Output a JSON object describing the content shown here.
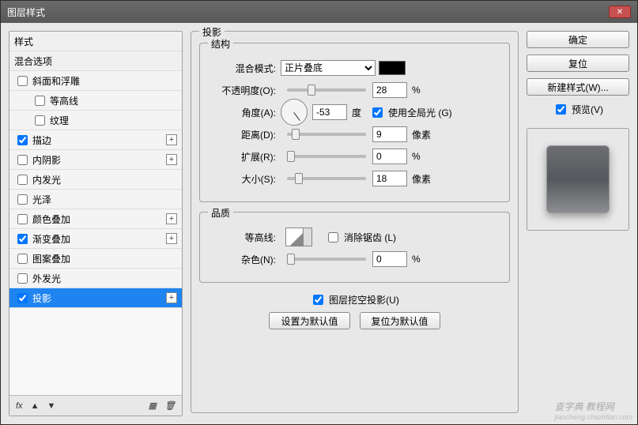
{
  "window": {
    "title": "图层样式"
  },
  "sidebar": {
    "header_styles": "样式",
    "header_blend": "混合选项",
    "items": [
      {
        "label": "斜面和浮雕",
        "checked": false,
        "expandable": false,
        "child": false
      },
      {
        "label": "等高线",
        "checked": false,
        "expandable": false,
        "child": true
      },
      {
        "label": "纹理",
        "checked": false,
        "expandable": false,
        "child": true
      },
      {
        "label": "描边",
        "checked": true,
        "expandable": true,
        "child": false
      },
      {
        "label": "内阴影",
        "checked": false,
        "expandable": true,
        "child": false
      },
      {
        "label": "内发光",
        "checked": false,
        "expandable": false,
        "child": false
      },
      {
        "label": "光泽",
        "checked": false,
        "expandable": false,
        "child": false
      },
      {
        "label": "颜色叠加",
        "checked": false,
        "expandable": true,
        "child": false
      },
      {
        "label": "渐变叠加",
        "checked": true,
        "expandable": true,
        "child": false
      },
      {
        "label": "图案叠加",
        "checked": false,
        "expandable": false,
        "child": false
      },
      {
        "label": "外发光",
        "checked": false,
        "expandable": false,
        "child": false
      },
      {
        "label": "投影",
        "checked": true,
        "expandable": true,
        "child": false,
        "active": true
      }
    ],
    "footer_fx": "fx"
  },
  "panel": {
    "title": "投影",
    "structure_title": "结构",
    "blend_mode_label": "混合模式:",
    "blend_mode_value": "正片叠底",
    "opacity_label": "不透明度(O):",
    "opacity_value": "28",
    "opacity_unit": "%",
    "angle_label": "角度(A):",
    "angle_value": "-53",
    "angle_unit": "度",
    "use_global_label": "使用全局光 (G)",
    "use_global_checked": true,
    "distance_label": "距离(D):",
    "distance_value": "9",
    "distance_unit": "像素",
    "spread_label": "扩展(R):",
    "spread_value": "0",
    "spread_unit": "%",
    "size_label": "大小(S):",
    "size_value": "18",
    "size_unit": "像素",
    "quality_title": "品质",
    "contour_label": "等高线:",
    "antialias_label": "消除锯齿 (L)",
    "antialias_checked": false,
    "noise_label": "杂色(N):",
    "noise_value": "0",
    "noise_unit": "%",
    "knockout_label": "图层挖空投影(U)",
    "knockout_checked": true,
    "set_default": "设置为默认值",
    "reset_default": "复位为默认值"
  },
  "right": {
    "ok": "确定",
    "cancel": "复位",
    "new_style": "新建样式(W)...",
    "preview_label": "预览(V)",
    "preview_checked": true
  },
  "watermark": {
    "line1": "查字典 教程网",
    "line2": "jiaocheng.chazidian.com"
  },
  "colors": {
    "swatch": "#000000",
    "active_row": "#1e84f0"
  }
}
